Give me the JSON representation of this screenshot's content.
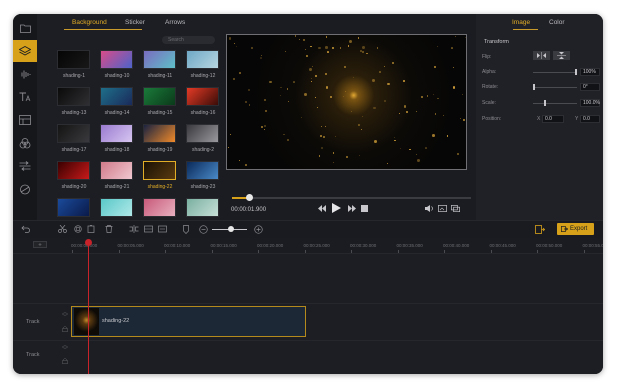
{
  "library": {
    "tabs": [
      "Background",
      "Sticker",
      "Arrows"
    ],
    "active_tab": "Background",
    "search_placeholder": "Search",
    "items": [
      {
        "label": "shading-1",
        "c1": "#050505",
        "c2": "#181818"
      },
      {
        "label": "shading-10",
        "c1": "#d84c8a",
        "c2": "#4d63c9"
      },
      {
        "label": "shading-11",
        "c1": "#7a6cc0",
        "c2": "#5fc0c8"
      },
      {
        "label": "shading-12",
        "c1": "#6fa8c6",
        "c2": "#b7d6e0"
      },
      {
        "label": "shading-13",
        "c1": "#0a0a0a",
        "c2": "#2f2f33"
      },
      {
        "label": "shading-14",
        "c1": "#1e6f8a",
        "c2": "#1a2a5a"
      },
      {
        "label": "shading-15",
        "c1": "#1a7a3a",
        "c2": "#0b3a1a"
      },
      {
        "label": "shading-16",
        "c1": "#e53a25",
        "c2": "#3a0c08"
      },
      {
        "label": "shading-17",
        "c1": "#141414",
        "c2": "#3a3a3e"
      },
      {
        "label": "shading-18",
        "c1": "#9a7bd0",
        "c2": "#d7c6f0"
      },
      {
        "label": "shading-19",
        "c1": "#1a2340",
        "c2": "#f08a2a"
      },
      {
        "label": "shading-2",
        "c1": "#3a3a3e",
        "c2": "#9a9a9e"
      },
      {
        "label": "shading-20",
        "c1": "#3a0000",
        "c2": "#c81a1a"
      },
      {
        "label": "shading-21",
        "c1": "#d07a8a",
        "c2": "#f0c8d0"
      },
      {
        "label": "shading-22",
        "c1": "#1a1205",
        "c2": "#5a3a10"
      },
      {
        "label": "shading-23",
        "c1": "#0a2a5a",
        "c2": "#4a8ac8"
      },
      {
        "label": "",
        "c1": "#1a4a9a",
        "c2": "#0a1a4a"
      },
      {
        "label": "",
        "c1": "#5ac8c8",
        "c2": "#b0e8e8"
      },
      {
        "label": "",
        "c1": "#c85a7a",
        "c2": "#e8b0c0"
      },
      {
        "label": "",
        "c1": "#7ab0a0",
        "c2": "#c8e0d8"
      }
    ],
    "selected": "shading-22"
  },
  "preview": {
    "timecode": "00:00:01.900",
    "progress_fraction": 0.07
  },
  "props": {
    "tabs": [
      "Image",
      "Color"
    ],
    "active_tab": "Image",
    "section": "Transform",
    "flip_label": "Flip:",
    "alpha_label": "Alpha:",
    "alpha_value": "100%",
    "alpha_fraction": 1.0,
    "rotate_label": "Rotate:",
    "rotate_value": "0°",
    "scale_label": "Scale:",
    "scale_value": "100.0%",
    "position_label": "Position:",
    "x_label": "X",
    "x_value": "0.0",
    "y_label": "Y",
    "y_value": "0.0"
  },
  "toolbar": {
    "export_label": "Export"
  },
  "timeline": {
    "ticks": [
      "00:00:00.000",
      "00:00:05.000",
      "00:00:10.000",
      "00:00:15.000",
      "00:00:20.000",
      "00:00:25.000",
      "00:00:30.000",
      "00:00:35.000",
      "00:00:40.000",
      "00:00:45.000",
      "00:00:50.000",
      "00:00:55.000"
    ],
    "track_labels": [
      "Track",
      "Track"
    ],
    "clip_label": "shading-22",
    "accent": "#d7a21a",
    "playhead_color": "#c8232b"
  }
}
